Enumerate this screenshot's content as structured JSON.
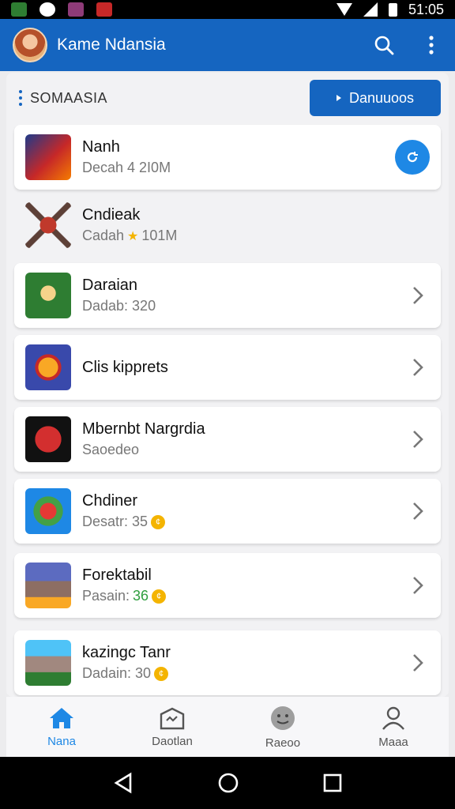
{
  "status_bar": {
    "time": "51:05"
  },
  "app_bar": {
    "title": "Kame Ndansia"
  },
  "section": {
    "title": "SOMAASIA",
    "download_label": "Danuuoos"
  },
  "apps": [
    {
      "name": "Nanh",
      "subtitle": "Decah 4 2I0M",
      "action": "refresh"
    },
    {
      "name": "Cndieak",
      "subtitle_pre": "Cadah",
      "subtitle_post": "101M",
      "badge": "star"
    },
    {
      "name": "Daraian",
      "subtitle": "Dadab: 320"
    },
    {
      "name": "Clis kipprets",
      "subtitle": ""
    },
    {
      "name": "Mbernbt Nargrdia",
      "subtitle": "Saoedeo"
    },
    {
      "name": "Chdiner",
      "subtitle": "Desatr: 35",
      "badge": "coin"
    },
    {
      "name": "Forektabil",
      "subtitle_pre": "Pasain:",
      "subtitle_num": "36",
      "badge": "coin"
    },
    {
      "name": "kazingc Tanr",
      "subtitle": "Dadain: 30",
      "badge": "coin"
    }
  ],
  "bottom_nav": [
    {
      "label": "Nana",
      "icon": "home-icon",
      "active": true
    },
    {
      "label": "Daotlan",
      "icon": "store-icon",
      "active": false
    },
    {
      "label": "Raeoo",
      "icon": "face-icon",
      "active": false
    },
    {
      "label": "Maaa",
      "icon": "person-icon",
      "active": false
    }
  ],
  "colors": {
    "primary": "#1565c0",
    "accent": "#1e88e5",
    "coin": "#f4b400"
  }
}
